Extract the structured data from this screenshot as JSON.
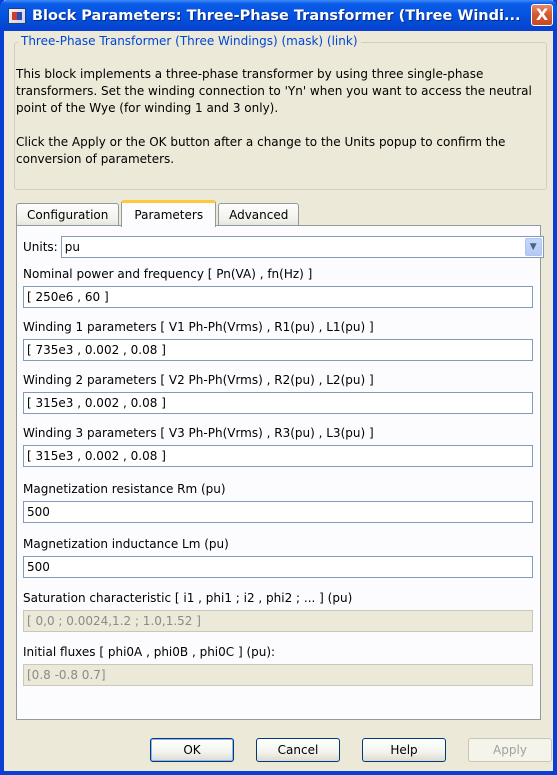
{
  "window": {
    "title": "Block Parameters: Three-Phase Transformer (Three Windi...",
    "close_glyph": "X"
  },
  "description": {
    "legend": "Three-Phase Transformer (Three Windings) (mask) (link)",
    "paragraph1": "This block implements a three-phase transformer by using three single-phase transformers. Set the winding connection to 'Yn' when you want to access the neutral point of the Wye (for winding 1 and 3 only).",
    "paragraph2": "Click the Apply or the OK button after a change to the Units popup to confirm the conversion of parameters."
  },
  "tabs": {
    "configuration": "Configuration",
    "parameters": "Parameters",
    "advanced": "Advanced",
    "active": "parameters"
  },
  "units": {
    "label": "Units:",
    "value": "pu"
  },
  "params": {
    "nominal": {
      "label": "Nominal power and frequency  [ Pn(VA) , fn(Hz) ]",
      "value": "[ 250e6 , 60 ]"
    },
    "winding1": {
      "label": "Winding 1 parameters [ V1 Ph-Ph(Vrms) , R1(pu) , L1(pu) ]",
      "value": "[ 735e3 , 0.002 , 0.08 ]"
    },
    "winding2": {
      "label": "Winding 2 parameters [ V2 Ph-Ph(Vrms) , R2(pu) , L2(pu) ]",
      "value": "[ 315e3 , 0.002 , 0.08 ]"
    },
    "winding3": {
      "label": "Winding 3 parameters [ V3 Ph-Ph(Vrms) , R3(pu) , L3(pu) ]",
      "value": "[ 315e3 , 0.002 , 0.08 ]"
    },
    "rm": {
      "label": "Magnetization resistance  Rm (pu)",
      "value": "500"
    },
    "lm": {
      "label": "Magnetization inductance  Lm (pu)",
      "value": "500"
    },
    "saturation": {
      "label": "Saturation characteristic [ i1 ,  phi1 ;  i2 , phi2 ; ... ] (pu)",
      "value": "[ 0,0 ; 0.0024,1.2 ; 1.0,1.52 ]"
    },
    "fluxes": {
      "label": "Initial fluxes [ phi0A , phi0B , phi0C ] (pu):",
      "value": "[0.8 -0.8 0.7]"
    }
  },
  "buttons": {
    "ok": "OK",
    "cancel": "Cancel",
    "help": "Help",
    "apply": "Apply"
  },
  "colors": {
    "titlebar": "#0552e0",
    "legend_text": "#0046d5",
    "tab_highlight": "#ffc83c",
    "dialog_bg": "#ece9d8"
  }
}
